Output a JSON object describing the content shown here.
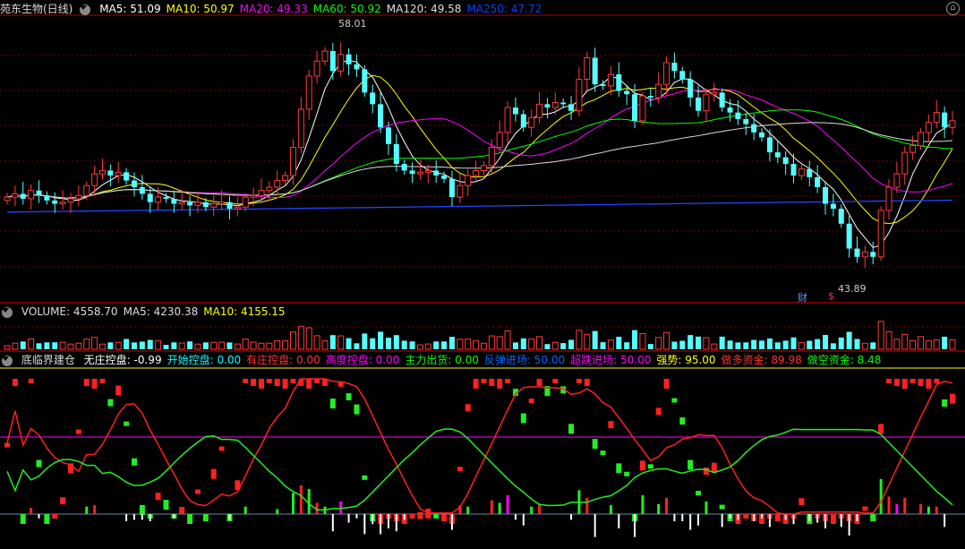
{
  "main_panel": {
    "title": "苑东生物(日线)",
    "indicators": [
      {
        "label": "MA5: 51.09",
        "color": "#ffffff"
      },
      {
        "label": "MA10: 50.97",
        "color": "#ffff00"
      },
      {
        "label": "MA20: 49.33",
        "color": "#ff00ff"
      },
      {
        "label": "MA60: 50.92",
        "color": "#00ff00"
      },
      {
        "label": "MA120: 49.58",
        "color": "#dddddd"
      },
      {
        "label": "MA250: 47.72",
        "color": "#0044ff"
      }
    ],
    "high_label": "58.01",
    "low_label": "43.89",
    "event_markers": [
      "财",
      "$"
    ]
  },
  "volume_panel": {
    "indicators": [
      {
        "label": "VOLUME: 4558.70",
        "color": "#dddddd"
      },
      {
        "label": "MA5: 4230.38",
        "color": "#dddddd"
      },
      {
        "label": "MA10: 4155.15",
        "color": "#ffff00"
      }
    ]
  },
  "indicator_panel": {
    "name": "底临界建仓",
    "values": [
      {
        "label": "无庄控盘: -0.99",
        "color": "#ffffff"
      },
      {
        "label": "开始控盘: 0.00",
        "color": "#00ffff"
      },
      {
        "label": "有庄控盘: 0.00",
        "color": "#ff3333"
      },
      {
        "label": "高度控盘: 0.00",
        "color": "#ff00ff"
      },
      {
        "label": "主力出货: 0.00",
        "color": "#00ff00"
      },
      {
        "label": "反弹进场: 50.00",
        "color": "#0066ff"
      },
      {
        "label": "超跌进场: 50.00",
        "color": "#ff00ff"
      },
      {
        "label": "强势: 95.00",
        "color": "#ffff00"
      },
      {
        "label": "做多资金: 89.98",
        "color": "#ff3333"
      },
      {
        "label": "做空资金: 8.48",
        "color": "#00ff00"
      }
    ]
  },
  "chart_data": [
    {
      "type": "candlestick",
      "title": "苑东生物(日线)",
      "bars": 120,
      "ylim": [
        42,
        59
      ],
      "annotations": {
        "high": 58.01,
        "low": 43.89
      },
      "close_approx": [
        48.2,
        48.4,
        48.1,
        48.6,
        48.3,
        48.0,
        47.8,
        47.9,
        48.1,
        48.3,
        48.9,
        49.6,
        49.8,
        49.5,
        49.7,
        49.2,
        48.8,
        48.4,
        47.9,
        48.2,
        48.1,
        47.8,
        47.9,
        47.7,
        47.9,
        47.6,
        47.8,
        47.9,
        47.5,
        47.6,
        48.2,
        48.3,
        48.6,
        48.8,
        49.2,
        49.5,
        51.2,
        53.5,
        55.5,
        56.4,
        57.0,
        55.8,
        56.8,
        56.2,
        55.9,
        54.5,
        53.8,
        52.4,
        51.4,
        50.2,
        49.8,
        49.6,
        49.7,
        49.8,
        49.5,
        49.3,
        48.2,
        48.9,
        49.5,
        49.8,
        50.1,
        51.2,
        52.1,
        53.6,
        53.2,
        52.4,
        53.0,
        53.8,
        53.6,
        53.9,
        53.8,
        53.4,
        55.3,
        56.6,
        55.0,
        54.9,
        55.6,
        54.6,
        54.4,
        52.8,
        54.3,
        54.2,
        55.0,
        56.3,
        55.8,
        55.3,
        54.2,
        53.4,
        54.4,
        54.5,
        53.6,
        53.3,
        52.9,
        52.6,
        52.1,
        51.8,
        50.9,
        50.6,
        50.2,
        49.5,
        49.9,
        49.4,
        48.8,
        47.8,
        47.5,
        46.6,
        45.1,
        44.6,
        44.9,
        44.6,
        47.4,
        48.8,
        49.6,
        50.9,
        51.3,
        52.1,
        52.7,
        53.3,
        52.4,
        52.8
      ],
      "series": [
        {
          "name": "MA5",
          "value": 51.09
        },
        {
          "name": "MA10",
          "value": 50.97
        },
        {
          "name": "MA20",
          "value": 49.33
        },
        {
          "name": "MA60",
          "value": 50.92
        },
        {
          "name": "MA120",
          "value": 49.58
        },
        {
          "name": "MA250",
          "value": 47.72
        }
      ]
    },
    {
      "type": "bar",
      "title": "VOLUME",
      "series": [
        {
          "name": "VOLUME",
          "value": 4558.7
        },
        {
          "name": "MA5",
          "value": 4230.38
        },
        {
          "name": "MA10",
          "value": 4155.15
        }
      ]
    },
    {
      "type": "bar",
      "title": "底临界建仓",
      "ylim": [
        0,
        100
      ],
      "series": [
        {
          "name": "强势",
          "value": 95.0
        },
        {
          "name": "做多资金",
          "value": 89.98
        },
        {
          "name": "做空资金",
          "value": 8.48
        }
      ]
    }
  ]
}
